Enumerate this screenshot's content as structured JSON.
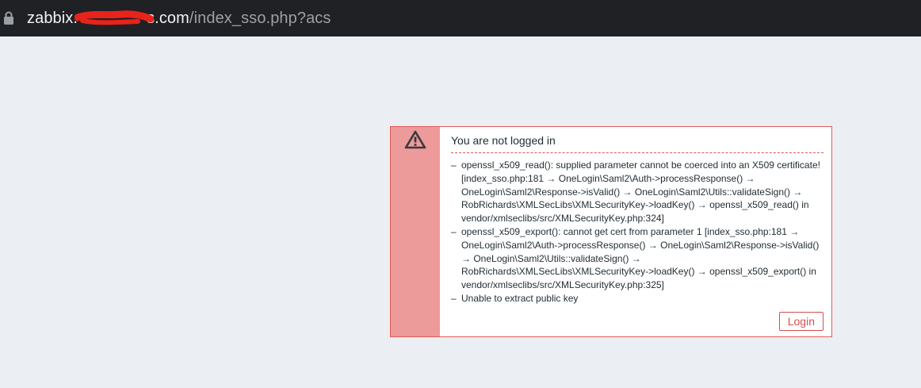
{
  "browser": {
    "url_host_start": "zabbix.",
    "url_host_end": "s.com",
    "url_path": "/index_sso.php?acs",
    "lock_icon": "lock-icon"
  },
  "message": {
    "icon": "warning-icon",
    "title": "You are not logged in",
    "details": [
      "openssl_x509_read(): supplied parameter cannot be coerced into an X509 certificate! [index_sso.php:181 → OneLogin\\Saml2\\Auth->processResponse() → OneLogin\\Saml2\\Response->isValid() → OneLogin\\Saml2\\Utils::validateSign() → RobRichards\\XMLSecLibs\\XMLSecurityKey->loadKey() → openssl_x509_read() in vendor/xmlseclibs/src/XMLSecurityKey.php:324]",
      "openssl_x509_export(): cannot get cert from parameter 1 [index_sso.php:181 → OneLogin\\Saml2\\Auth->processResponse() → OneLogin\\Saml2\\Response->isValid() → OneLogin\\Saml2\\Utils::validateSign() → RobRichards\\XMLSecLibs\\XMLSecurityKey->loadKey() → openssl_x509_export() in vendor/xmlseclibs/src/XMLSecurityKey.php:325]",
      "Unable to extract public key"
    ],
    "bullet": "–",
    "login_label": "Login"
  },
  "colors": {
    "error_border": "#e45959",
    "error_side": "#ec9a9a",
    "button_text": "#d64e4e",
    "page_bg": "#ebeef2",
    "bar_bg": "#202124"
  }
}
